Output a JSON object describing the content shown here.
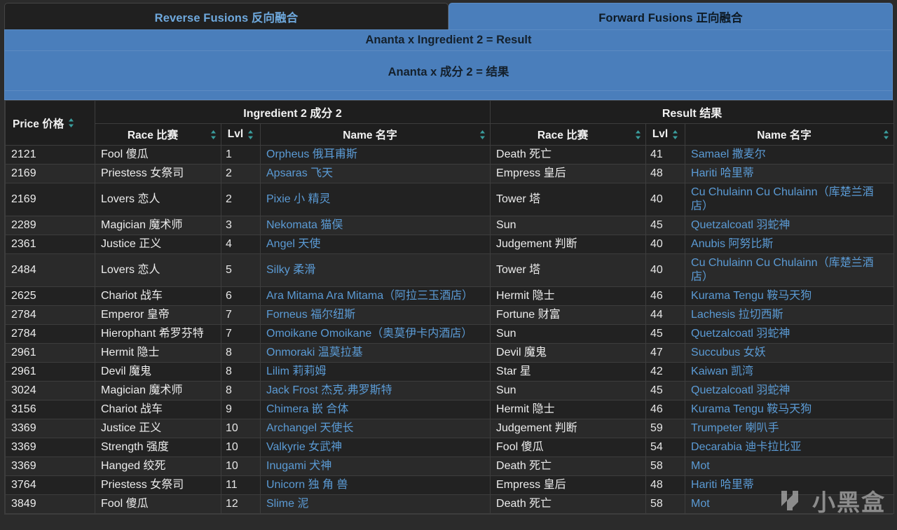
{
  "tabs": [
    {
      "label": "Reverse Fusions 反向融合",
      "active": true
    },
    {
      "label": "Forward Fusions 正向融合",
      "active": false
    }
  ],
  "banner": {
    "line_en": "Ananta x Ingredient 2 = Result",
    "line_zh": "Ananta x 成分 2 = 结果"
  },
  "table": {
    "group_headers": {
      "price": "Price 价格",
      "ingredient": "Ingredient 2 成分 2",
      "result": "Result 结果"
    },
    "sub_headers": {
      "race": "Race 比赛",
      "lvl": "Lvl",
      "name": "Name 名字"
    },
    "rows": [
      {
        "price": "2121",
        "irace": "Fool 傻瓜",
        "ilvl": "1",
        "iname": "Orpheus 俄耳甫斯",
        "rrace": "Death 死亡",
        "rlvl": "41",
        "rname": "Samael 撒麦尔"
      },
      {
        "price": "2169",
        "irace": "Priestess 女祭司",
        "ilvl": "2",
        "iname": "Apsaras 飞天",
        "rrace": "Empress 皇后",
        "rlvl": "48",
        "rname": "Hariti 哈里蒂"
      },
      {
        "price": "2169",
        "irace": "Lovers 恋人",
        "ilvl": "2",
        "iname": "Pixie 小 精灵",
        "rrace": "Tower 塔",
        "rlvl": "40",
        "rname": "Cu Chulainn Cu Chulainn（库楚兰酒店）"
      },
      {
        "price": "2289",
        "irace": "Magician 魔术师",
        "ilvl": "3",
        "iname": "Nekomata 猫俣",
        "rrace": "Sun",
        "rlvl": "45",
        "rname": "Quetzalcoatl 羽蛇神"
      },
      {
        "price": "2361",
        "irace": "Justice 正义",
        "ilvl": "4",
        "iname": "Angel 天使",
        "rrace": "Judgement 判断",
        "rlvl": "40",
        "rname": "Anubis 阿努比斯"
      },
      {
        "price": "2484",
        "irace": "Lovers 恋人",
        "ilvl": "5",
        "iname": "Silky 柔滑",
        "rrace": "Tower 塔",
        "rlvl": "40",
        "rname": "Cu Chulainn Cu Chulainn（库楚兰酒店）"
      },
      {
        "price": "2625",
        "irace": "Chariot 战车",
        "ilvl": "6",
        "iname": "Ara Mitama Ara Mitama（阿拉三玉酒店）",
        "rrace": "Hermit 隐士",
        "rlvl": "46",
        "rname": "Kurama Tengu 鞍马天狗"
      },
      {
        "price": "2784",
        "irace": "Emperor 皇帝",
        "ilvl": "7",
        "iname": "Forneus 福尔纽斯",
        "rrace": "Fortune 财富",
        "rlvl": "44",
        "rname": "Lachesis 拉切西斯"
      },
      {
        "price": "2784",
        "irace": "Hierophant 希罗芬特",
        "ilvl": "7",
        "iname": "Omoikane Omoikane（奥莫伊卡内酒店）",
        "rrace": "Sun",
        "rlvl": "45",
        "rname": "Quetzalcoatl 羽蛇神"
      },
      {
        "price": "2961",
        "irace": "Hermit 隐士",
        "ilvl": "8",
        "iname": "Onmoraki 温莫拉基",
        "rrace": "Devil 魔鬼",
        "rlvl": "47",
        "rname": "Succubus 女妖"
      },
      {
        "price": "2961",
        "irace": "Devil 魔鬼",
        "ilvl": "8",
        "iname": "Lilim 莉莉姆",
        "rrace": "Star 星",
        "rlvl": "42",
        "rname": "Kaiwan 凯湾"
      },
      {
        "price": "3024",
        "irace": "Magician 魔术师",
        "ilvl": "8",
        "iname": "Jack Frost 杰克·弗罗斯特",
        "rrace": "Sun",
        "rlvl": "45",
        "rname": "Quetzalcoatl 羽蛇神"
      },
      {
        "price": "3156",
        "irace": "Chariot 战车",
        "ilvl": "9",
        "iname": "Chimera 嵌 合体",
        "rrace": "Hermit 隐士",
        "rlvl": "46",
        "rname": "Kurama Tengu 鞍马天狗"
      },
      {
        "price": "3369",
        "irace": "Justice 正义",
        "ilvl": "10",
        "iname": "Archangel 天使长",
        "rrace": "Judgement 判断",
        "rlvl": "59",
        "rname": "Trumpeter 喇叭手"
      },
      {
        "price": "3369",
        "irace": "Strength 强度",
        "ilvl": "10",
        "iname": "Valkyrie 女武神",
        "rrace": "Fool 傻瓜",
        "rlvl": "54",
        "rname": "Decarabia 迪卡拉比亚"
      },
      {
        "price": "3369",
        "irace": "Hanged 绞死",
        "ilvl": "10",
        "iname": "Inugami 犬神",
        "rrace": "Death 死亡",
        "rlvl": "58",
        "rname": "Mot"
      },
      {
        "price": "3764",
        "irace": "Priestess 女祭司",
        "ilvl": "11",
        "iname": "Unicorn 独 角 兽",
        "rrace": "Empress 皇后",
        "rlvl": "48",
        "rname": "Hariti 哈里蒂"
      },
      {
        "price": "3849",
        "irace": "Fool 傻瓜",
        "ilvl": "12",
        "iname": "Slime 泥",
        "rrace": "Death 死亡",
        "rlvl": "58",
        "rname": "Mot"
      }
    ]
  },
  "watermark": {
    "text": "小黑盒"
  },
  "colors": {
    "accent_blue": "#4a7ebb",
    "link_blue": "#5b9bd5",
    "tab_active_text": "#6ea8dc",
    "sort_icon": "#3a9e9e",
    "background": "#2b2b2b"
  }
}
